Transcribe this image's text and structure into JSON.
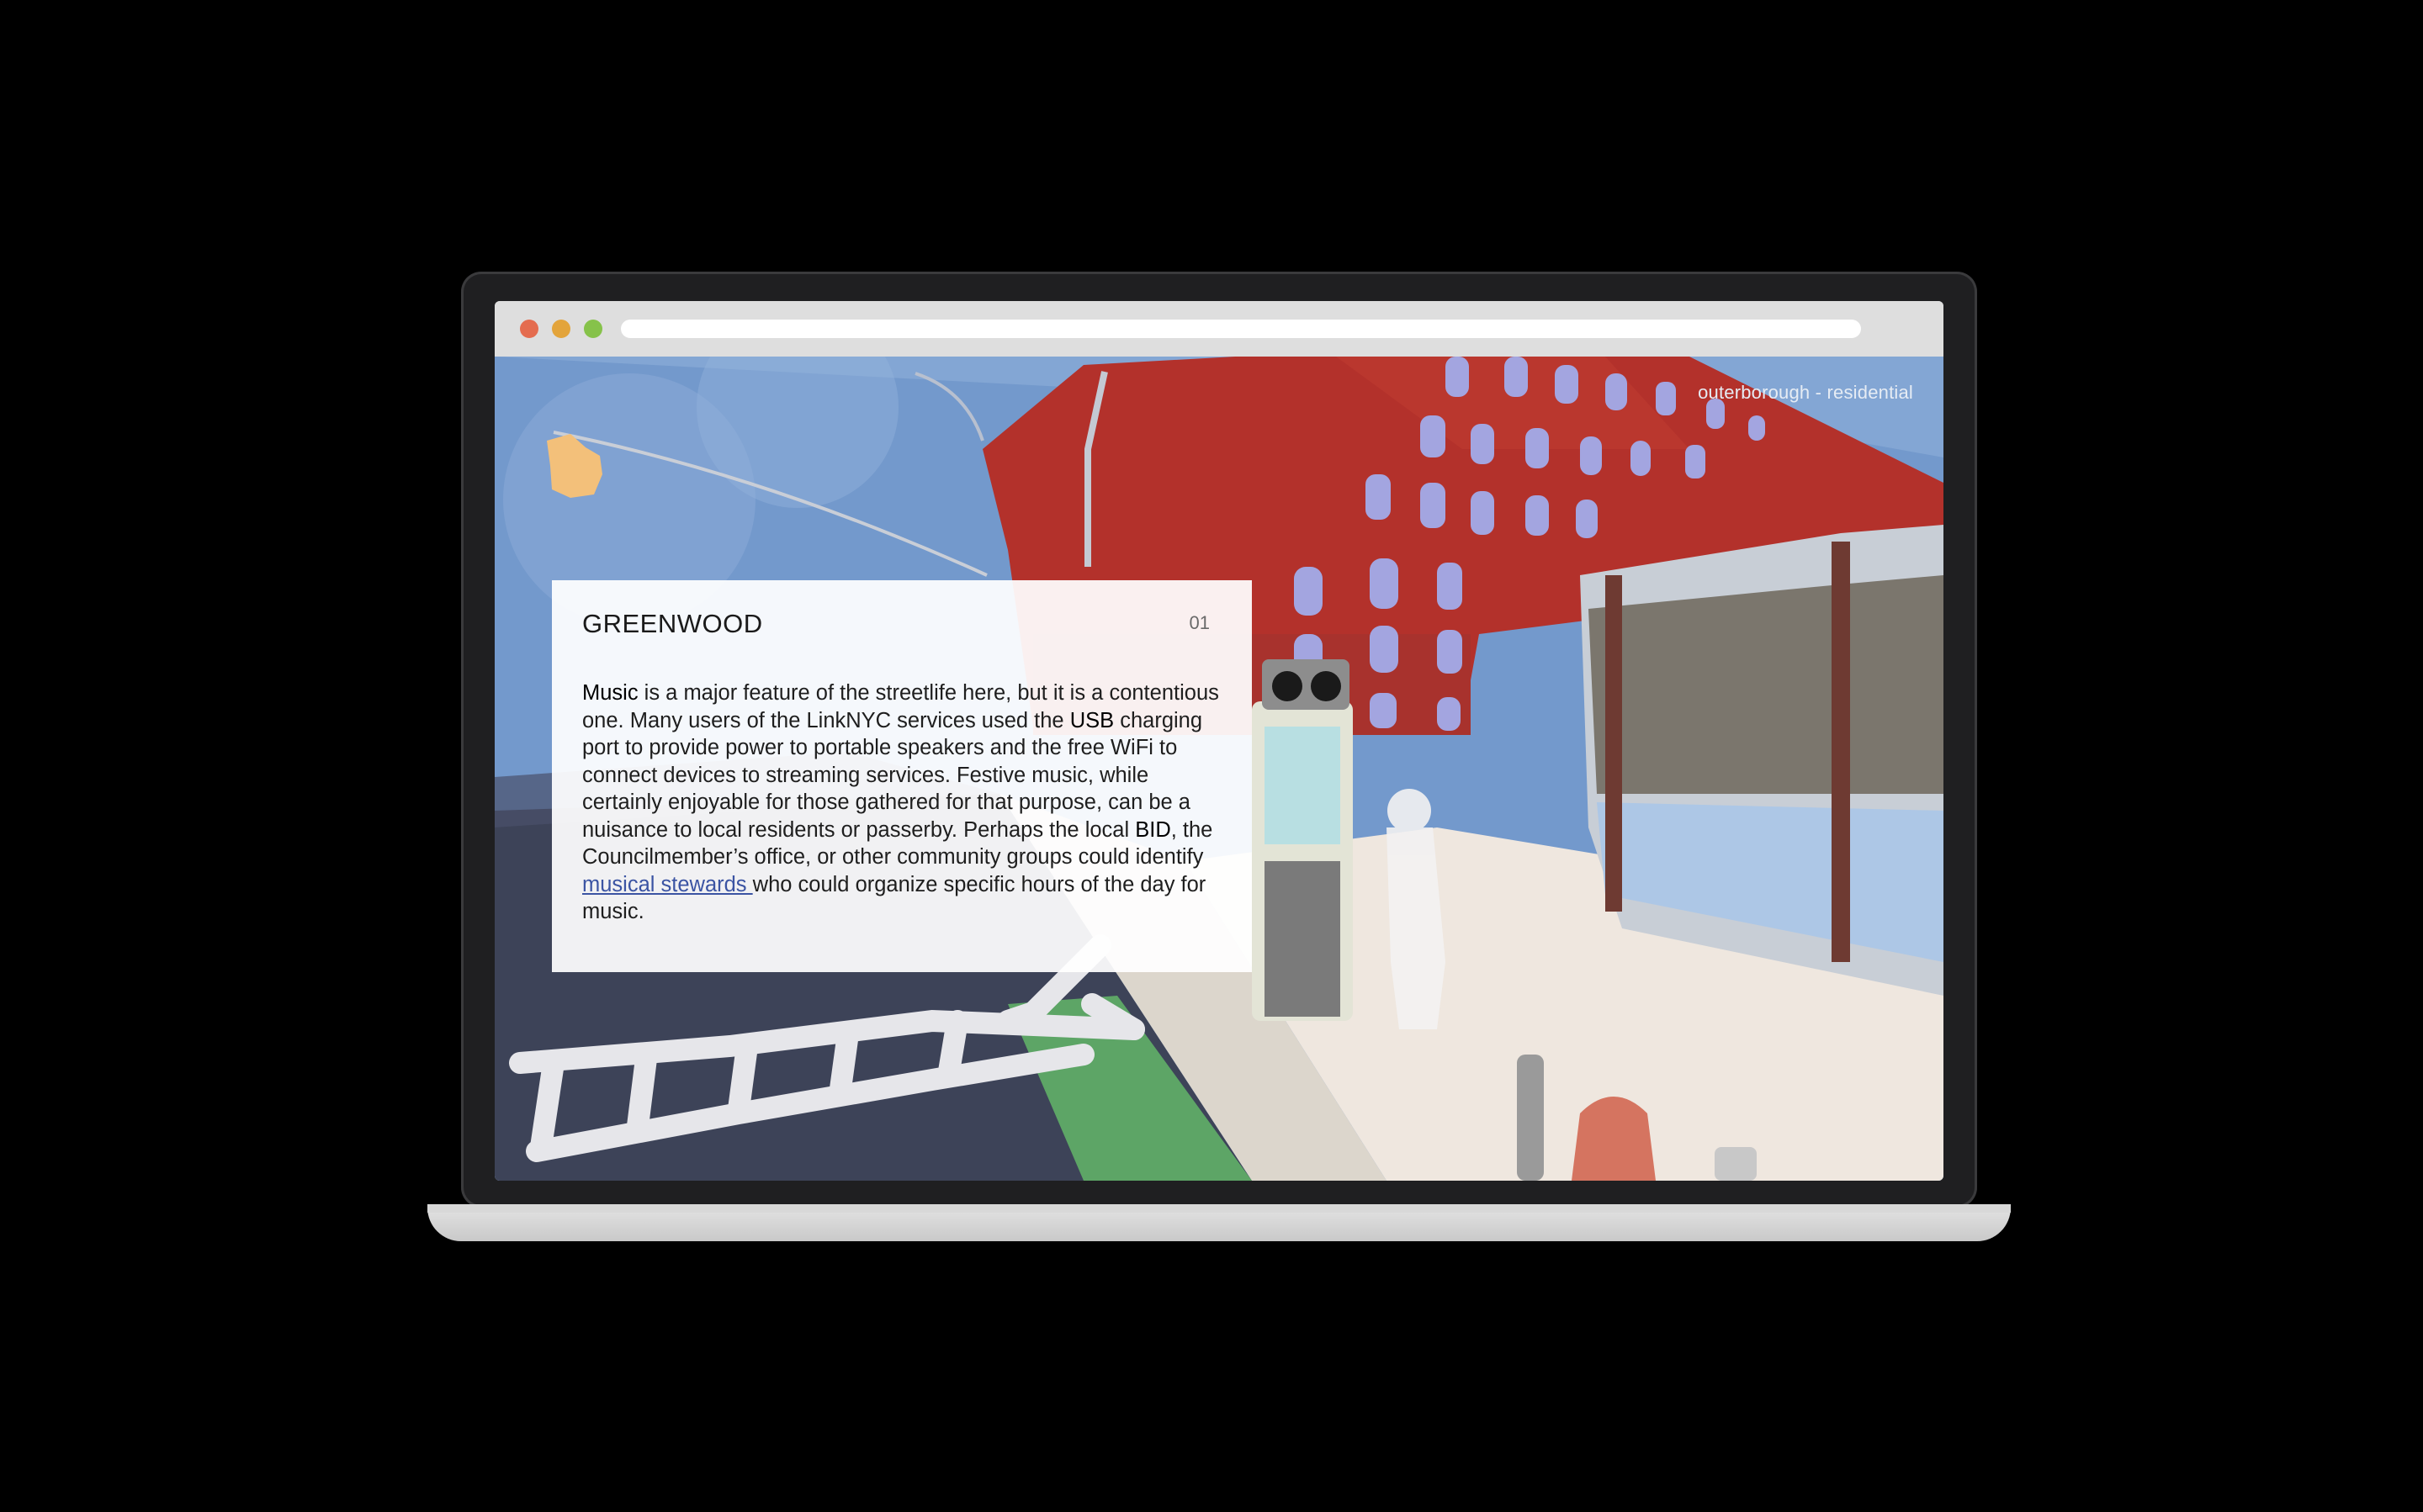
{
  "browser": {
    "window_controls": [
      "close",
      "minimize",
      "maximize"
    ],
    "address_bar": {
      "value": ""
    }
  },
  "page": {
    "category_tag": "outerborough - residential",
    "card": {
      "title": "GREENWOOD",
      "index": "01",
      "body": {
        "kw_music": "Music",
        "t1": " is a major feature of the streetlife here, but it is a contentious one. Many users of the LinkNYC services used the ",
        "kw_usb": "USB",
        "t2": " charging port to provide power to portable speakers and the free WiFi to connect devices to streaming services. Festive music, while certainly enjoyable for those gathered for that purpose, can be a nuisance to local residents or passerby. Perhaps the local ",
        "kw_bid": "BID",
        "t3": ", the Councilmember’s office, or other community groups could identify ",
        "link": "musical stewards ",
        "t4": " who could organize specific hours of the day for music."
      }
    }
  },
  "colors": {
    "sky": "#6f93c8",
    "building": "#b3312b",
    "windows": "#a3a5e0",
    "road": "#3d4358",
    "bike_lane": "#5da566",
    "sidewalk": "#efe7df",
    "link": "#3b54a3"
  },
  "icons": [
    "traffic-light-icon",
    "boombox-icon",
    "linknyc-kiosk-icon",
    "fire-hydrant-icon",
    "bollard-icon"
  ]
}
